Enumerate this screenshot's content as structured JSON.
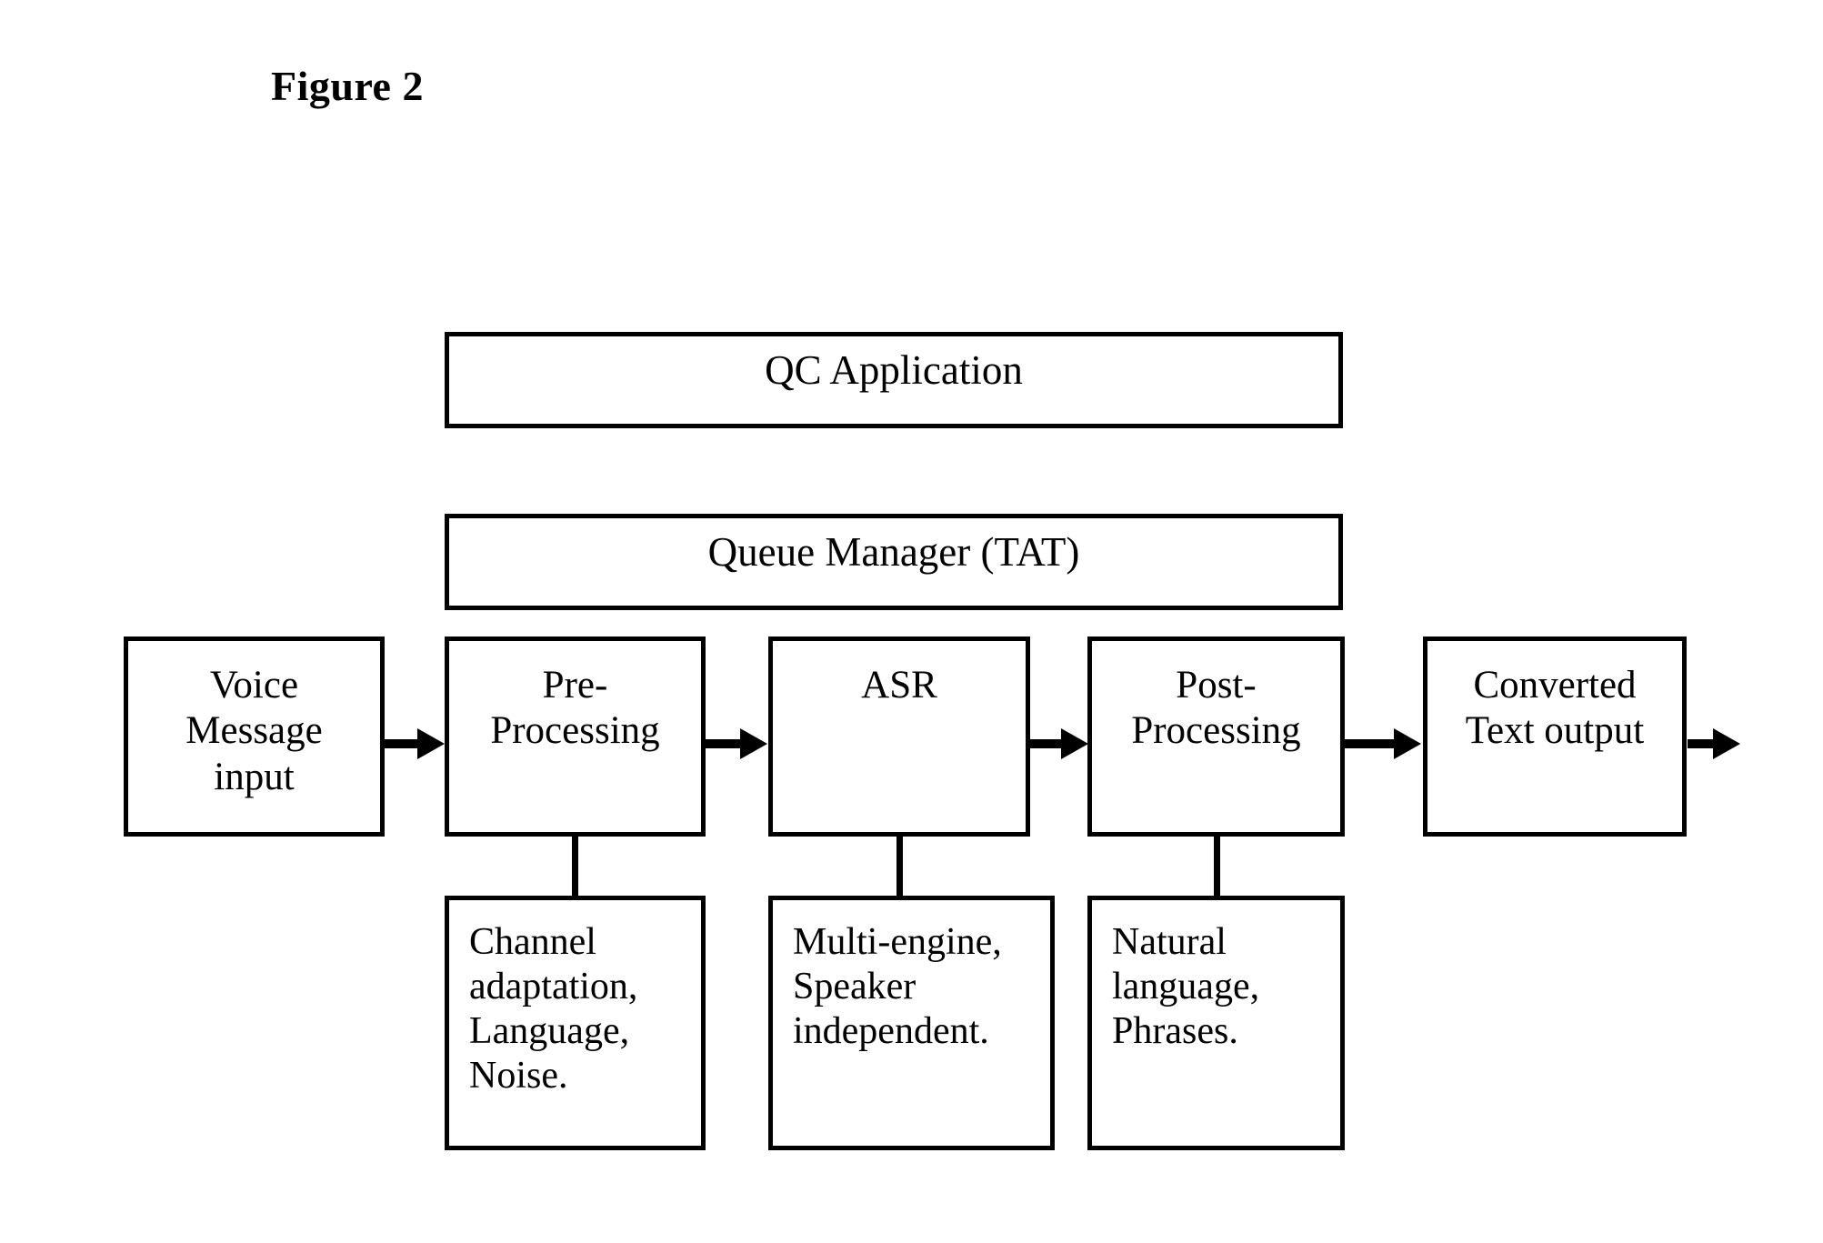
{
  "figure": {
    "title": "Figure 2"
  },
  "banners": [
    {
      "id": "qc-application",
      "label": "QC Application"
    },
    {
      "id": "queue-manager",
      "label": "Queue Manager (TAT)"
    }
  ],
  "pipeline": [
    {
      "id": "voice-message-input",
      "lines": [
        "Voice",
        "Message",
        "input"
      ]
    },
    {
      "id": "pre-processing",
      "lines": [
        "Pre-",
        "Processing"
      ]
    },
    {
      "id": "asr",
      "lines": [
        "ASR"
      ]
    },
    {
      "id": "post-processing",
      "lines": [
        "Post-",
        "Processing"
      ]
    },
    {
      "id": "converted-text-output",
      "lines": [
        "Converted",
        "Text output"
      ]
    }
  ],
  "details": [
    {
      "id": "pre-processing-details",
      "lines": [
        "Channel",
        "adaptation,",
        "Language,",
        "Noise."
      ]
    },
    {
      "id": "asr-details",
      "lines": [
        "Multi-engine,",
        "Speaker",
        "independent."
      ]
    },
    {
      "id": "post-processing-details",
      "lines": [
        "Natural",
        "language,",
        "Phrases."
      ]
    }
  ],
  "colors": {
    "stroke": "#000000",
    "background": "#ffffff"
  }
}
